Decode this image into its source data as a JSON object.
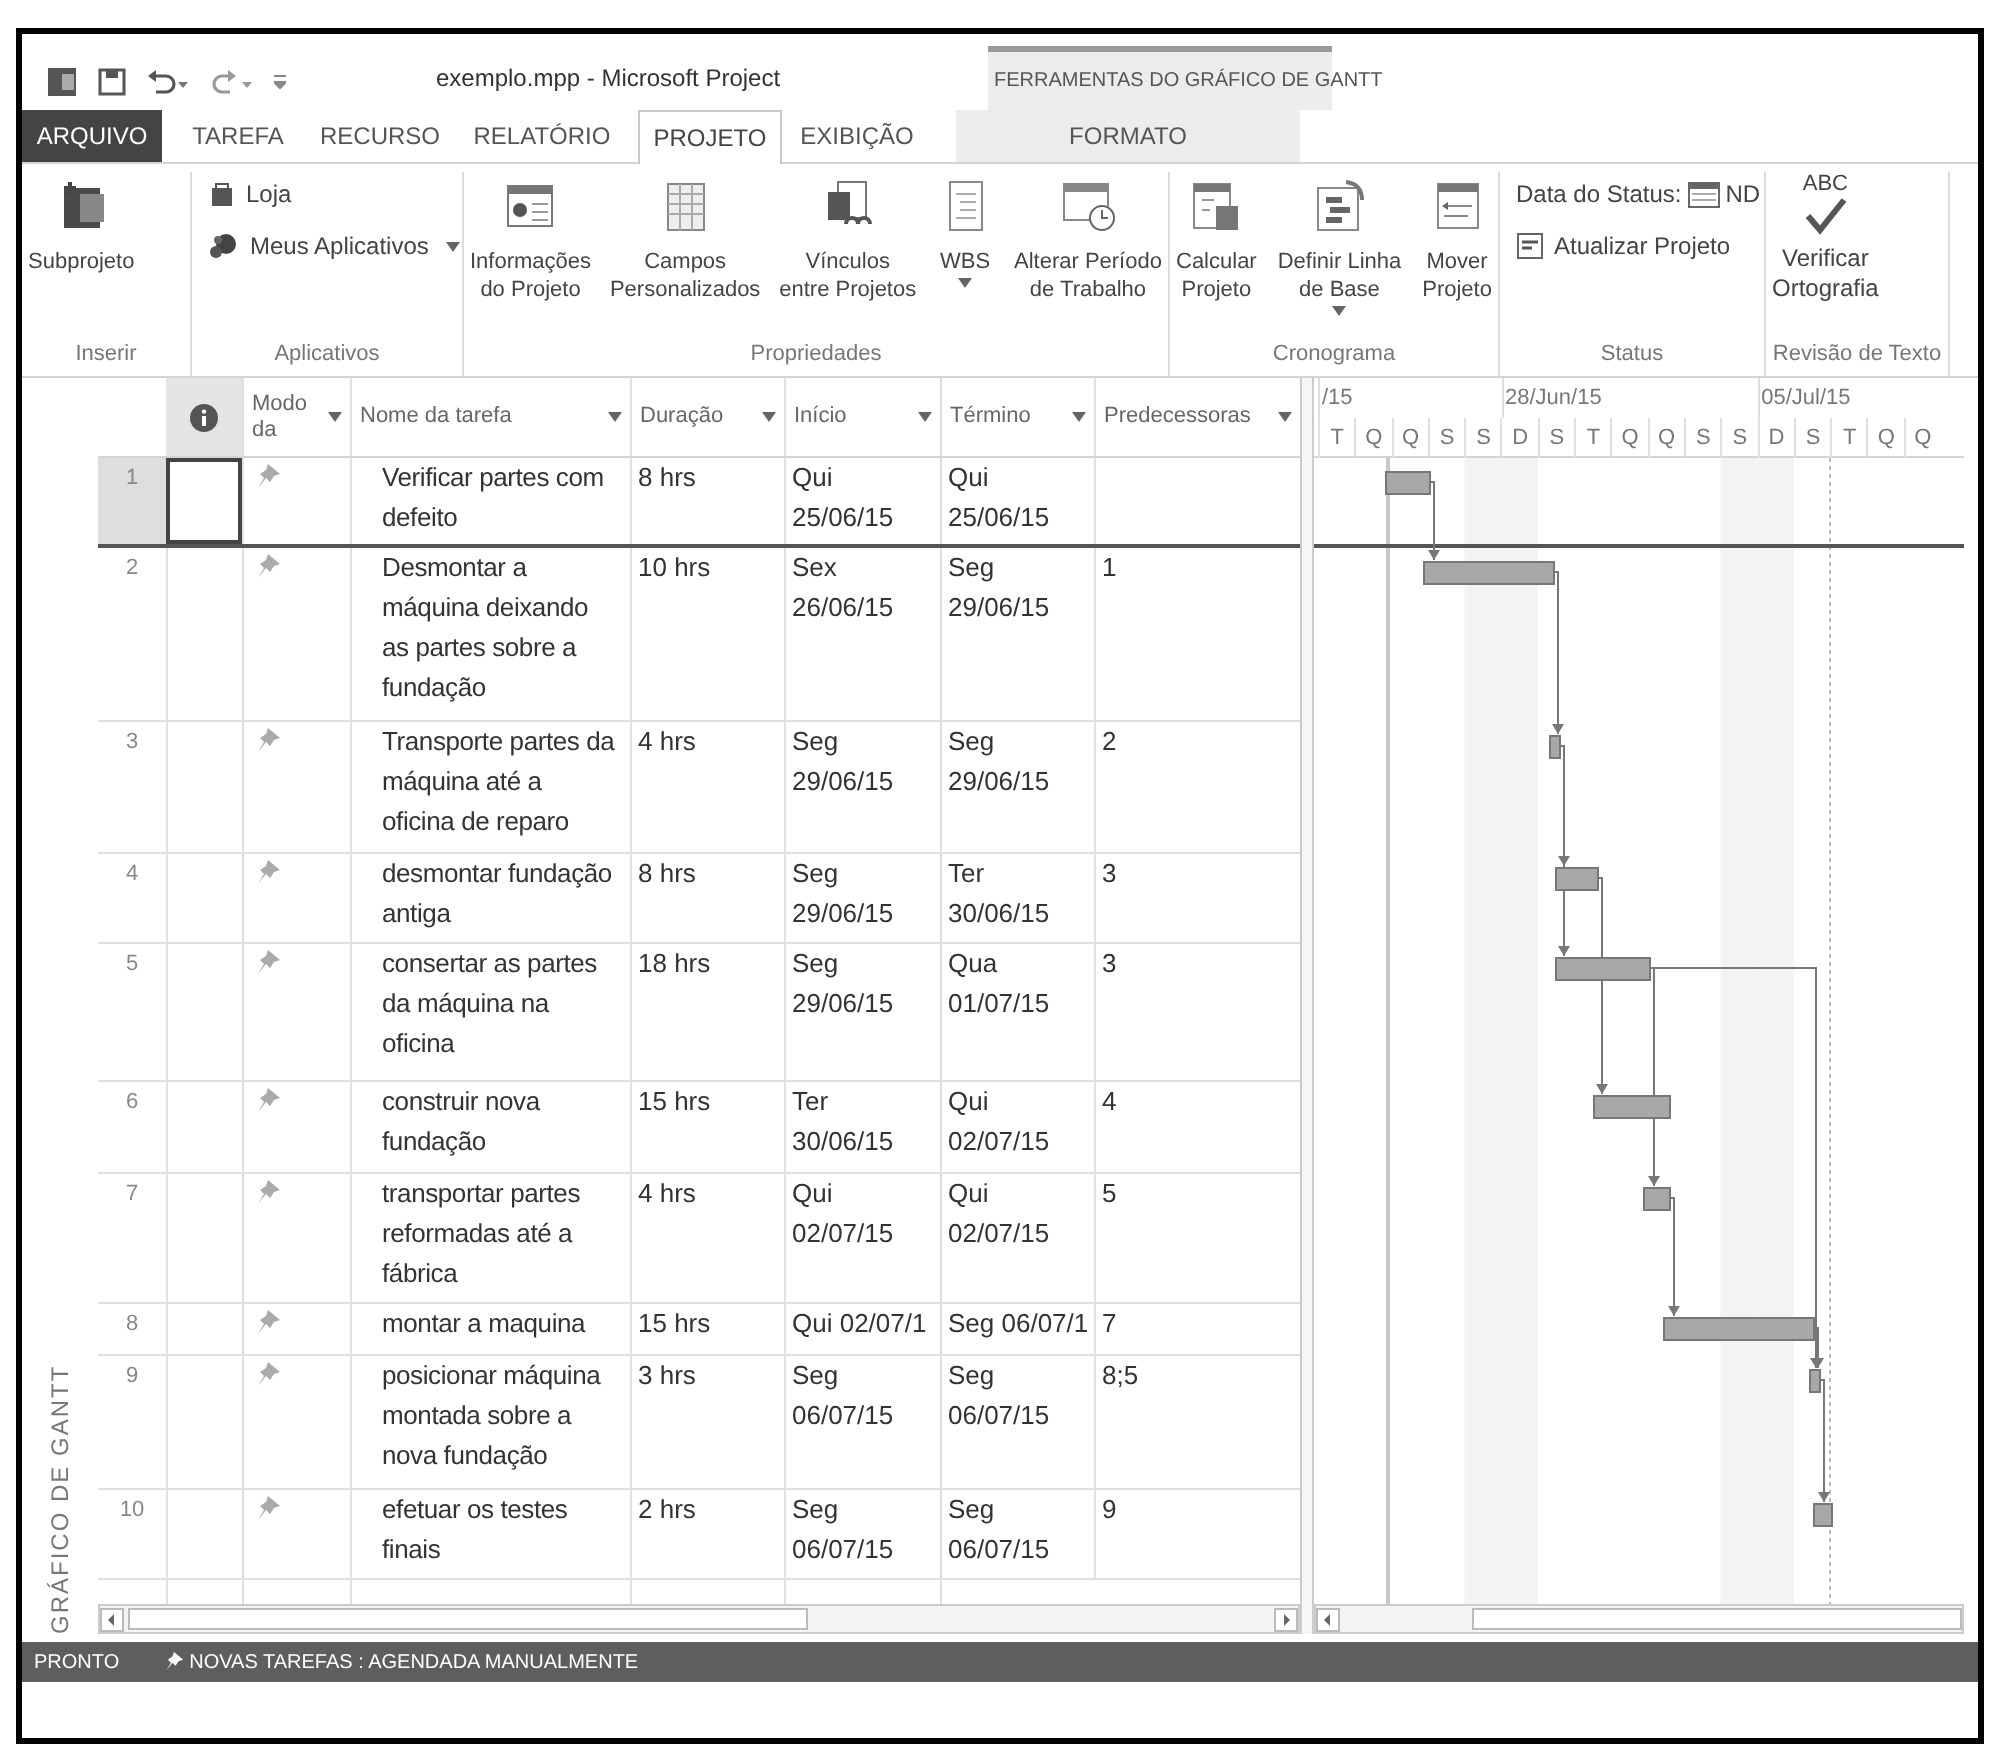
{
  "window": {
    "title": "exemplo.mpp - Microsoft Project"
  },
  "contextual": {
    "title": "FERRAMENTAS DO GRÁFICO DE GANTT",
    "tabs": [
      {
        "label": "FORMATO",
        "selected": false
      }
    ]
  },
  "tabs": [
    {
      "label": "ARQUIVO",
      "kind": "file",
      "selected": false
    },
    {
      "label": "TAREFA",
      "kind": "tab",
      "selected": false
    },
    {
      "label": "RECURSO",
      "kind": "tab",
      "selected": false
    },
    {
      "label": "RELATÓRIO",
      "kind": "tab",
      "selected": false
    },
    {
      "label": "PROJETO",
      "kind": "tab",
      "selected": true
    },
    {
      "label": "EXIBIÇÃO",
      "kind": "tab",
      "selected": false
    }
  ],
  "ribbon": {
    "groups": [
      {
        "label": "Inserir",
        "commands": [
          {
            "kind": "large",
            "lines": [
              "Subprojeto"
            ],
            "dropdown": false
          }
        ]
      },
      {
        "label": "Aplicativos",
        "commands": [
          {
            "kind": "small",
            "label": "Loja",
            "dropdown": false
          },
          {
            "kind": "small",
            "label": "Meus Aplicativos",
            "dropdown": true
          }
        ]
      },
      {
        "label": "Propriedades",
        "commands": [
          {
            "kind": "large",
            "lines": [
              "Informações",
              "do Projeto"
            ],
            "dropdown": false
          },
          {
            "kind": "large",
            "lines": [
              "Campos",
              "Personalizados"
            ],
            "dropdown": false
          },
          {
            "kind": "large",
            "lines": [
              "Vínculos",
              "entre Projetos"
            ],
            "dropdown": false
          },
          {
            "kind": "large",
            "lines": [
              "WBS"
            ],
            "dropdown": true
          },
          {
            "kind": "large",
            "lines": [
              "Alterar Período",
              "de Trabalho"
            ],
            "dropdown": false
          }
        ]
      },
      {
        "label": "Cronograma",
        "commands": [
          {
            "kind": "large",
            "lines": [
              "Calcular",
              "Projeto"
            ],
            "dropdown": false
          },
          {
            "kind": "large",
            "lines": [
              "Definir Linha",
              "de Base"
            ],
            "dropdown": true
          },
          {
            "kind": "large",
            "lines": [
              "Mover",
              "Projeto"
            ],
            "dropdown": false
          }
        ]
      },
      {
        "label": "Status",
        "commands": [
          {
            "kind": "status_date",
            "label": "Data do Status:",
            "value": "ND"
          },
          {
            "kind": "small",
            "label": "Atualizar Projeto",
            "dropdown": false
          }
        ]
      },
      {
        "label": "Revisão de Texto",
        "commands": [
          {
            "kind": "spelling",
            "icon_text": "ABC",
            "lines": [
              "Verificar",
              "Ortografia"
            ]
          }
        ]
      }
    ]
  },
  "side_label": "GRÁFICO DE GANTT",
  "table": {
    "columns": [
      {
        "label": "Modo da",
        "dropdown": true
      },
      {
        "label": "Nome da tarefa",
        "dropdown": true
      },
      {
        "label": "Duração",
        "dropdown": true
      },
      {
        "label": "Início",
        "dropdown": true
      },
      {
        "label": "Término",
        "dropdown": true
      },
      {
        "label": "Predecessoras",
        "dropdown": true
      }
    ],
    "rows": [
      {
        "id": "1",
        "name": [
          "Verificar partes com",
          "defeito"
        ],
        "duration": "8 hrs",
        "start": "Qui 25/06/15",
        "finish": "Qui 25/06/15",
        "selected": true
      },
      {
        "id": "2",
        "name": [
          "Desmontar a",
          "máquina deixando",
          "as partes sobre a",
          "fundação"
        ],
        "duration": "10 hrs",
        "start": "Sex 26/06/15",
        "finish": "Seg 29/06/15",
        "predecessors": "1",
        "selected": false
      },
      {
        "id": "3",
        "name": [
          "Transporte partes da",
          "máquina até a",
          "oficina de reparo"
        ],
        "duration": "4 hrs",
        "start": "Seg 29/06/15",
        "finish": "Seg 29/06/15",
        "predecessors": "2",
        "selected": false
      },
      {
        "id": "4",
        "name": [
          "desmontar fundação",
          "antiga"
        ],
        "duration": "8 hrs",
        "start": "Seg 29/06/15",
        "finish": "Ter 30/06/15",
        "predecessors": "3",
        "selected": false
      },
      {
        "id": "5",
        "name": [
          "consertar as partes",
          "da máquina na",
          "oficina"
        ],
        "duration": "18 hrs",
        "start": "Seg 29/06/15",
        "finish": "Qua 01/07/15",
        "predecessors": "3",
        "selected": false
      },
      {
        "id": "6",
        "name": [
          "construir nova",
          "fundação"
        ],
        "duration": "15 hrs",
        "start": "Ter 30/06/15",
        "finish": "Qui 02/07/15",
        "predecessors": "4",
        "selected": false
      },
      {
        "id": "7",
        "name": [
          "transportar partes",
          "reformadas até a",
          "fábrica"
        ],
        "duration": "4 hrs",
        "start": "Qui 02/07/15",
        "finish": "Qui 02/07/15",
        "predecessors": "5",
        "selected": false
      },
      {
        "id": "8",
        "name": [
          "montar a maquina"
        ],
        "duration": "15 hrs",
        "start": "Qui 02/07/1",
        "finish": "Seg 06/07/1",
        "predecessors": "7",
        "selected": false
      },
      {
        "id": "9",
        "name": [
          "posicionar máquina",
          "montada sobre a",
          "nova fundação"
        ],
        "duration": "3 hrs",
        "start": "Seg 06/07/15",
        "finish": "Seg 06/07/15",
        "predecessors": "8;5",
        "selected": false
      },
      {
        "id": "10",
        "name": [
          "efetuar os testes",
          "finais"
        ],
        "duration": "2 hrs",
        "start": "Seg 06/07/15",
        "finish": "Seg 06/07/15",
        "predecessors": "9",
        "selected": false
      }
    ]
  },
  "timescale": {
    "weeks": [
      "/15",
      "28/Jun/15",
      "05/Jul/15"
    ],
    "days": [
      {
        "label": "T",
        "weekend": false
      },
      {
        "label": "Q",
        "weekend": false
      },
      {
        "label": "Q",
        "weekend": false
      },
      {
        "label": "S",
        "weekend": false
      },
      {
        "label": "S",
        "weekend": true
      },
      {
        "label": "D",
        "weekend": true
      },
      {
        "label": "S",
        "weekend": false
      },
      {
        "label": "T",
        "weekend": false
      },
      {
        "label": "Q",
        "weekend": false
      },
      {
        "label": "Q",
        "weekend": false
      },
      {
        "label": "S",
        "weekend": false
      },
      {
        "label": "S",
        "weekend": true
      },
      {
        "label": "D",
        "weekend": true
      },
      {
        "label": "S",
        "weekend": false
      },
      {
        "label": "T",
        "weekend": false
      },
      {
        "label": "Q",
        "weekend": false
      },
      {
        "label": "Q",
        "weekend": false
      }
    ]
  },
  "status_bar": {
    "status": "PRONTO",
    "new_tasks": "NOVAS TAREFAS : AGENDADA MANUALMENTE"
  }
}
